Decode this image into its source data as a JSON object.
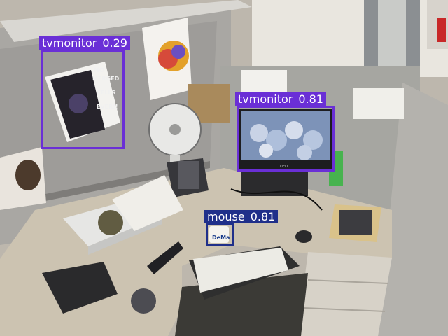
{
  "scene": {
    "colors": {
      "tvmonitor_box": "#6a2fd6",
      "mouse_box": "#1f2f8a"
    }
  },
  "detections": [
    {
      "label": "tvmonitor",
      "score": "0.29"
    },
    {
      "label": "tvmonitor",
      "score": "0.81"
    },
    {
      "label": "mouse",
      "score": "0.81"
    }
  ],
  "sign": {
    "lines": [
      "NO",
      "MERGED",
      "CELLS",
      "EVER!!"
    ]
  },
  "monitor": {
    "brand": "DELL"
  },
  "mug": {
    "text": "DeMa"
  }
}
